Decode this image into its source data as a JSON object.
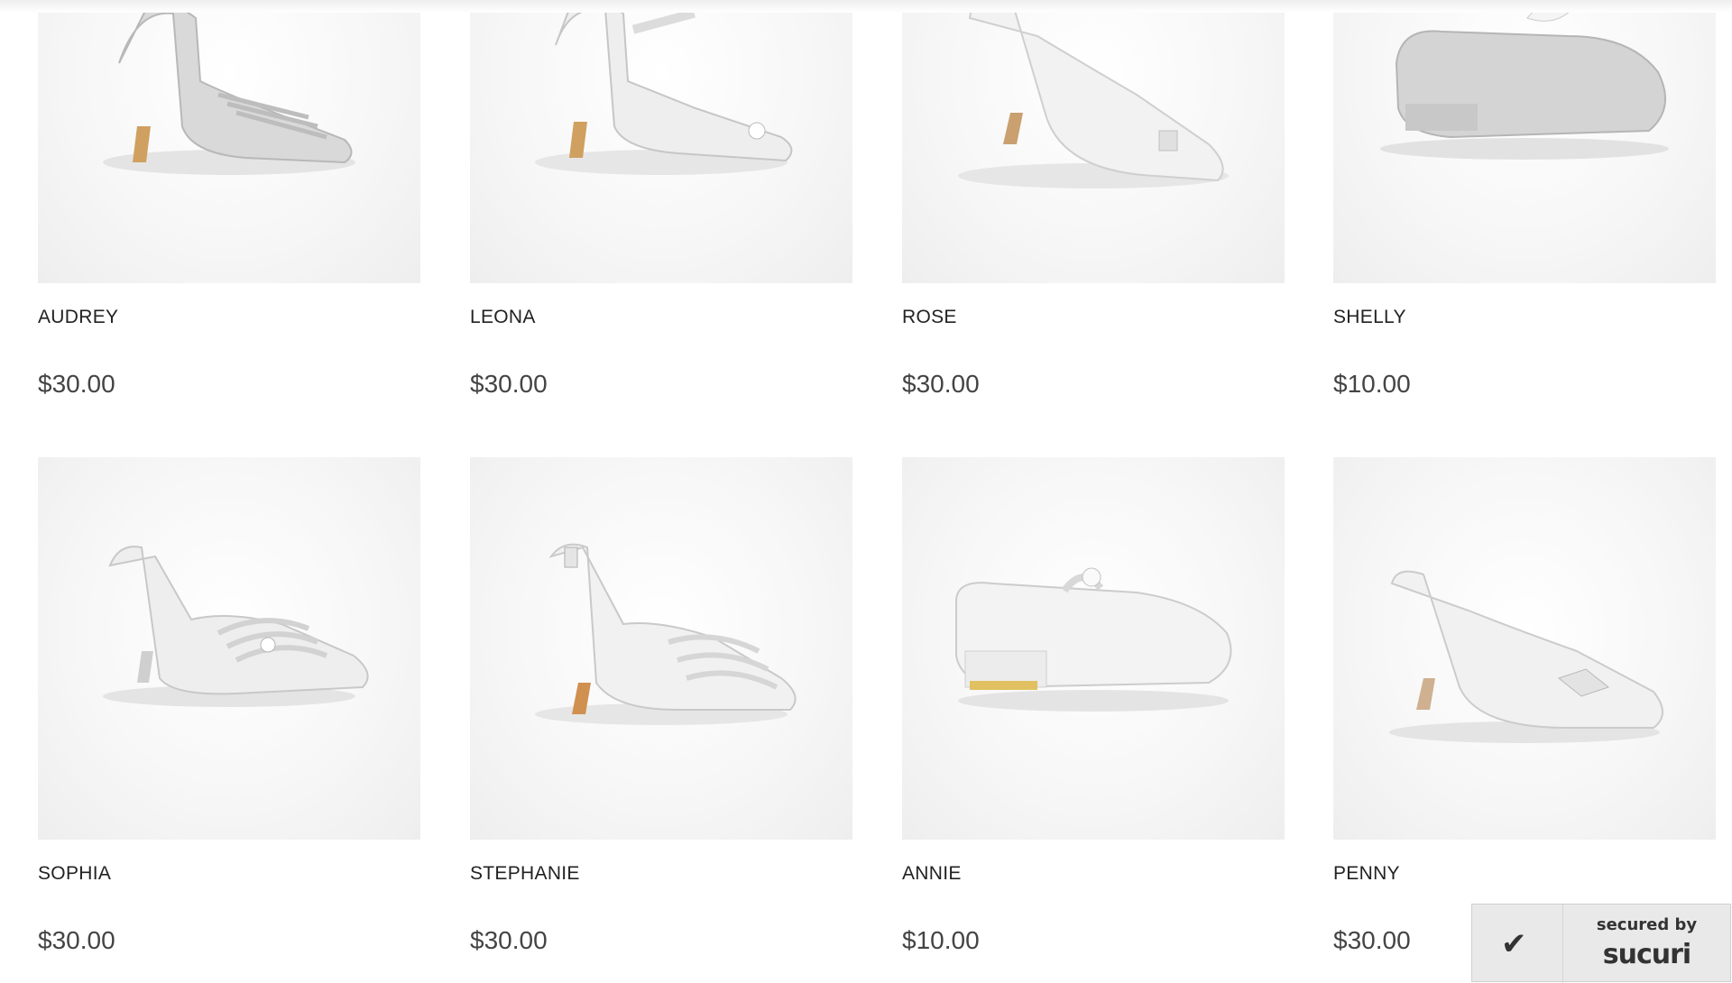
{
  "products": [
    {
      "name": "AUDREY",
      "price": "$30.00",
      "icon": "strappy-heel-sandal"
    },
    {
      "name": "LEONA",
      "price": "$30.00",
      "icon": "ankle-strap-peep-toe"
    },
    {
      "name": "ROSE",
      "price": "$30.00",
      "icon": "peep-toe-pump"
    },
    {
      "name": "SHELLY",
      "price": "$10.00",
      "icon": "glitter-mary-jane-flat"
    },
    {
      "name": "SOPHIA",
      "price": "$30.00",
      "icon": "strappy-heel-sandal"
    },
    {
      "name": "STEPHANIE",
      "price": "$30.00",
      "icon": "ankle-strap-sandal"
    },
    {
      "name": "ANNIE",
      "price": "$10.00",
      "icon": "mary-jane-low-heel"
    },
    {
      "name": "PENNY",
      "price": "$30.00",
      "icon": "court-pump"
    }
  ],
  "badge": {
    "line1": "secured by",
    "line2": "sucuri"
  }
}
